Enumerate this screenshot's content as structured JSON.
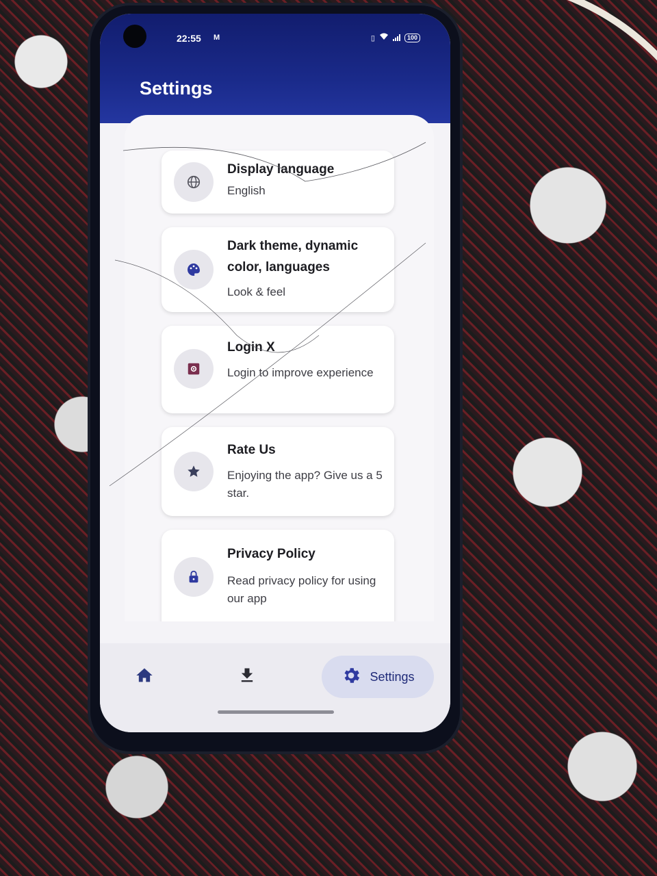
{
  "status_bar": {
    "time": "22:55",
    "indicator": "M",
    "battery": "100"
  },
  "header": {
    "title": "Settings"
  },
  "settings_items": [
    {
      "title": "Display language",
      "subtitle": "English",
      "icon": "globe-icon"
    },
    {
      "title": "Dark theme, dynamic color, languages",
      "subtitle": "Look & feel",
      "icon": "palette-icon"
    },
    {
      "title": "Login X",
      "subtitle": "Login to improve experience",
      "icon": "app-settings-icon"
    },
    {
      "title": "Rate Us",
      "subtitle": "Enjoying the app? Give us a 5 star.",
      "icon": "star-icon"
    },
    {
      "title": "Privacy Policy",
      "subtitle": "Read privacy policy for using our app",
      "icon": "lock-icon"
    }
  ],
  "bottom_nav": {
    "items": [
      {
        "icon": "home-icon",
        "label": ""
      },
      {
        "icon": "download-icon",
        "label": ""
      },
      {
        "icon": "gear-icon",
        "label": "Settings"
      }
    ],
    "active_index": 2
  },
  "colors": {
    "header": "#1a2a8a",
    "nav_active_pill": "#d9dcef",
    "accent": "#2f3aa0"
  }
}
